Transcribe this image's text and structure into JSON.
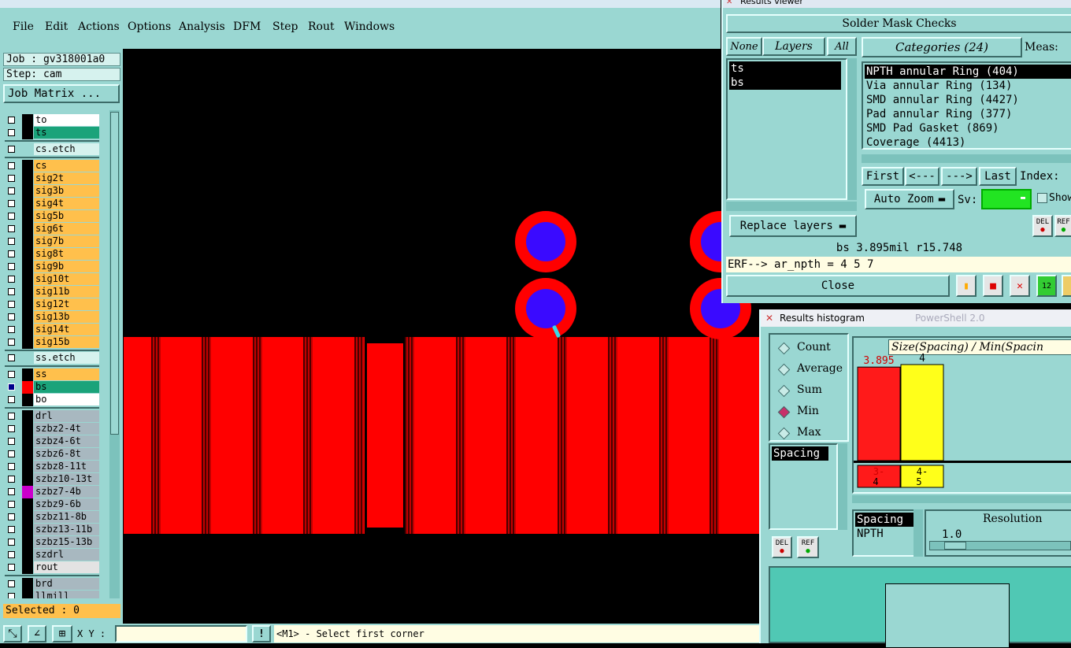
{
  "menubar": {
    "items": [
      "File",
      "Edit",
      "Actions",
      "Options",
      "Analysis",
      "DFM",
      "Step",
      "Rout",
      "Windows"
    ]
  },
  "left": {
    "job": "Job : gv318001a0",
    "step": "Step: cam",
    "job_matrix": "Job Matrix ...",
    "layers": {
      "to": "to",
      "ts": "ts",
      "cs_etch": "cs.etch",
      "cs": "cs",
      "sig2t": "sig2t",
      "sig3b": "sig3b",
      "sig4t": "sig4t",
      "sig5b": "sig5b",
      "sig6t": "sig6t",
      "sig7b": "sig7b",
      "sig8t": "sig8t",
      "sig9b": "sig9b",
      "sig10t": "sig10t",
      "sig11b": "sig11b",
      "sig12t": "sig12t",
      "sig13b": "sig13b",
      "sig14t": "sig14t",
      "sig15b": "sig15b",
      "ss_etch": "ss.etch",
      "ss": "ss",
      "bs": "bs",
      "bo": "bo",
      "drl": "drl",
      "szbz2_4t": "szbz2-4t",
      "szbz4_6t": "szbz4-6t",
      "szbz6_8t": "szbz6-8t",
      "szbz8_11t": "szbz8-11t",
      "szbz10_13t": "szbz10-13t",
      "szbz7_4b": "szbz7-4b",
      "szbz9_6b": "szbz9-6b",
      "szbz11_8b": "szbz11-8b",
      "szbz13_11b": "szbz13-11b",
      "szbz15_13b": "szbz15-13b",
      "szdrl": "szdrl",
      "rout": "rout",
      "brd": "brd",
      "llmill": "llmill"
    },
    "selected": "Selected : 0"
  },
  "status": {
    "xy_label": "X Y :",
    "xy_value": "",
    "warn": "!",
    "prompt": "<M1> - Select first corner"
  },
  "results_viewer": {
    "title": "Results viewer",
    "header": "Solder Mask Checks",
    "none": "None",
    "layers": "Layers",
    "all": "All",
    "categories": "Categories (24)",
    "meas": "Meas:",
    "layer_items": [
      "ts",
      "bs"
    ],
    "category_items": [
      "NPTH annular Ring (404)",
      "Via annular Ring (134)",
      "SMD annular Ring (4427)",
      "Pad annular Ring (377)",
      "SMD Pad Gasket (869)",
      "Coverage (4413)"
    ],
    "first": "First",
    "prev": "<---",
    "next": "--->",
    "last": "Last",
    "index": "Index:",
    "auto_zoom": "Auto Zoom",
    "sv": "Sv:",
    "show": "Show",
    "replace_layers": "Replace layers",
    "del": "DEL",
    "ref": "REF",
    "info": "bs 3.895mil  r15.748",
    "erf": "ERF--> ar_npth = 4 5 7",
    "close": "Close"
  },
  "histogram": {
    "title": "Results histogram",
    "bg_title": "PowerShell 2.0",
    "radios": [
      {
        "label": "Count",
        "selected": false
      },
      {
        "label": "Average",
        "selected": false
      },
      {
        "label": "Sum",
        "selected": false
      },
      {
        "label": "Min",
        "selected": true
      },
      {
        "label": "Max",
        "selected": false
      }
    ],
    "list_item": "Spacing",
    "chart_title": "Size(Spacing) / Min(Spacin",
    "list2": [
      "Spacing",
      "NPTH"
    ],
    "resolution_label": "Resolution",
    "resolution_value": "1.0",
    "del": "DEL",
    "ref": "REF"
  },
  "chart_data": {
    "type": "bar",
    "title": "Size(Spacing) / Min(Spacin",
    "categories": [
      "3-4",
      "4-5"
    ],
    "values": [
      3.895,
      4
    ],
    "value_labels": [
      "3.895",
      "4"
    ],
    "ylim": [
      0,
      4
    ],
    "colors": [
      "#ff1a1a",
      "#ffff1a"
    ],
    "xlabel": "",
    "ylabel": "",
    "grid": false
  },
  "colors": {
    "teal": "#9ad7d2",
    "pad_red": "#ff0000",
    "pad_blue": "#3a0aff",
    "layer_orange": "#ffc04c",
    "layer_green": "#1aa37a",
    "layer_grey": "#a8b8c0"
  }
}
